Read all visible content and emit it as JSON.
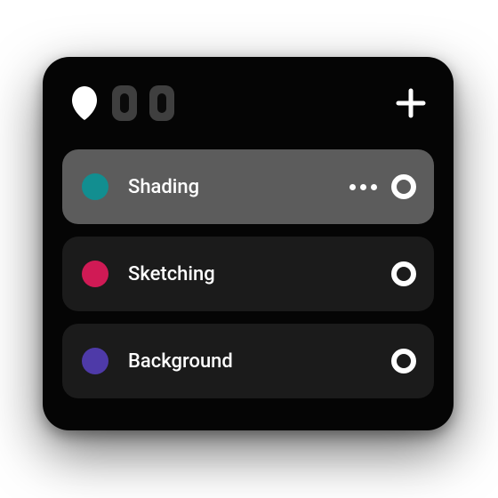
{
  "toolbar": {
    "icons": {
      "balloon": "balloon-icon",
      "slot1": "slot-icon",
      "slot2": "slot-icon",
      "plus": "plus-icon"
    }
  },
  "layers": [
    {
      "label": "Shading",
      "color": "#128e90",
      "active": true,
      "showMore": true
    },
    {
      "label": "Sketching",
      "color": "#d01a55",
      "active": false,
      "showMore": false
    },
    {
      "label": "Background",
      "color": "#4e3aa8",
      "active": false,
      "showMore": false
    }
  ]
}
